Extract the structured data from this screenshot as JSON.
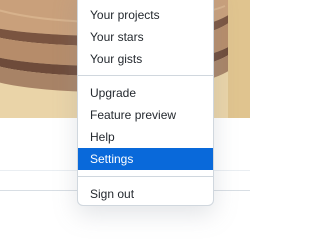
{
  "profile": {
    "avatar_icon": "avatar-image"
  },
  "user_menu": {
    "items_group_1": [
      {
        "label": "Your projects"
      },
      {
        "label": "Your stars"
      },
      {
        "label": "Your gists"
      }
    ],
    "items_group_2": [
      {
        "label": "Upgrade"
      },
      {
        "label": "Feature preview"
      },
      {
        "label": "Help"
      },
      {
        "label": "Settings",
        "active": true
      }
    ],
    "items_group_3": [
      {
        "label": "Sign out"
      }
    ],
    "active_color": "#0969da"
  }
}
